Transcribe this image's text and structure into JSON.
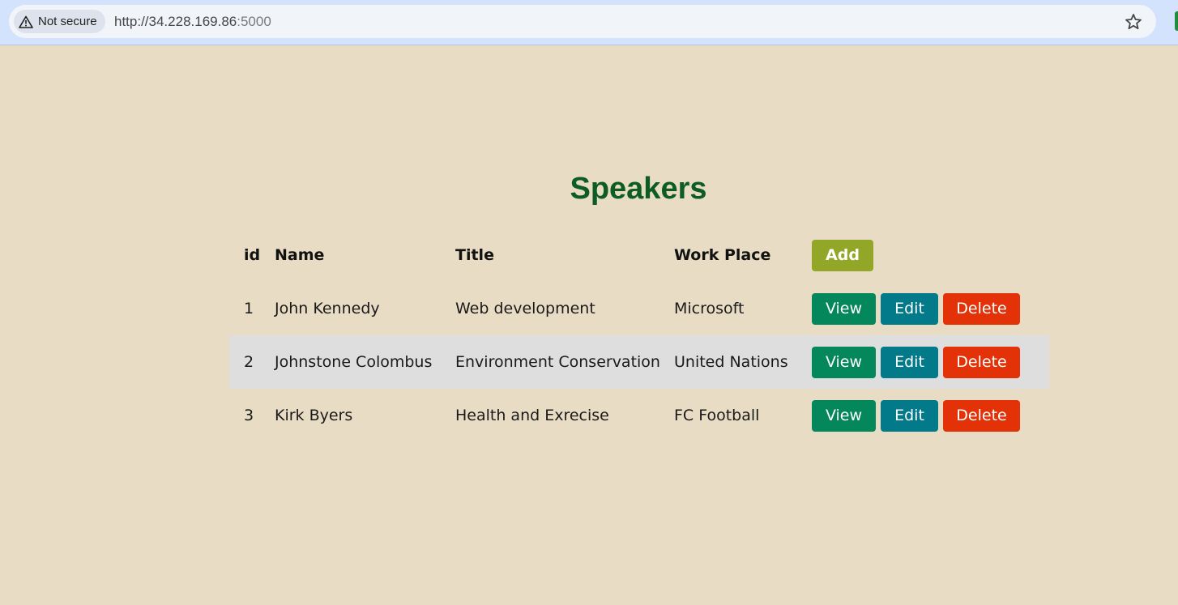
{
  "browser": {
    "security_label": "Not secure",
    "url_main": "http://34.228.169.86",
    "url_port": ":5000",
    "icons": [
      "warning-icon",
      "star-icon"
    ]
  },
  "page": {
    "title": "Speakers"
  },
  "table": {
    "headers": {
      "id": "id",
      "name": "Name",
      "title": "Title",
      "work_place": "Work Place",
      "add_label": "Add"
    },
    "rows": [
      {
        "id": "1",
        "name": "John Kennedy",
        "title": "Web development",
        "work_place": "Microsoft",
        "view": "View",
        "edit": "Edit",
        "delete": "Delete"
      },
      {
        "id": "2",
        "name": "Johnstone Colombus",
        "title": "Environment Conservation",
        "work_place": "United Nations",
        "view": "View",
        "edit": "Edit",
        "delete": "Delete"
      },
      {
        "id": "3",
        "name": "Kirk Byers",
        "title": "Health and Exrecise",
        "work_place": "FC Football",
        "view": "View",
        "edit": "Edit",
        "delete": "Delete"
      }
    ]
  },
  "colors": {
    "page_background": "#e8dcc4",
    "title_green": "#0c5c23",
    "add_button": "#92a628",
    "view_button": "#03875b",
    "edit_button": "#027a8a",
    "delete_button": "#e33108",
    "striped_row": "#dedede"
  }
}
